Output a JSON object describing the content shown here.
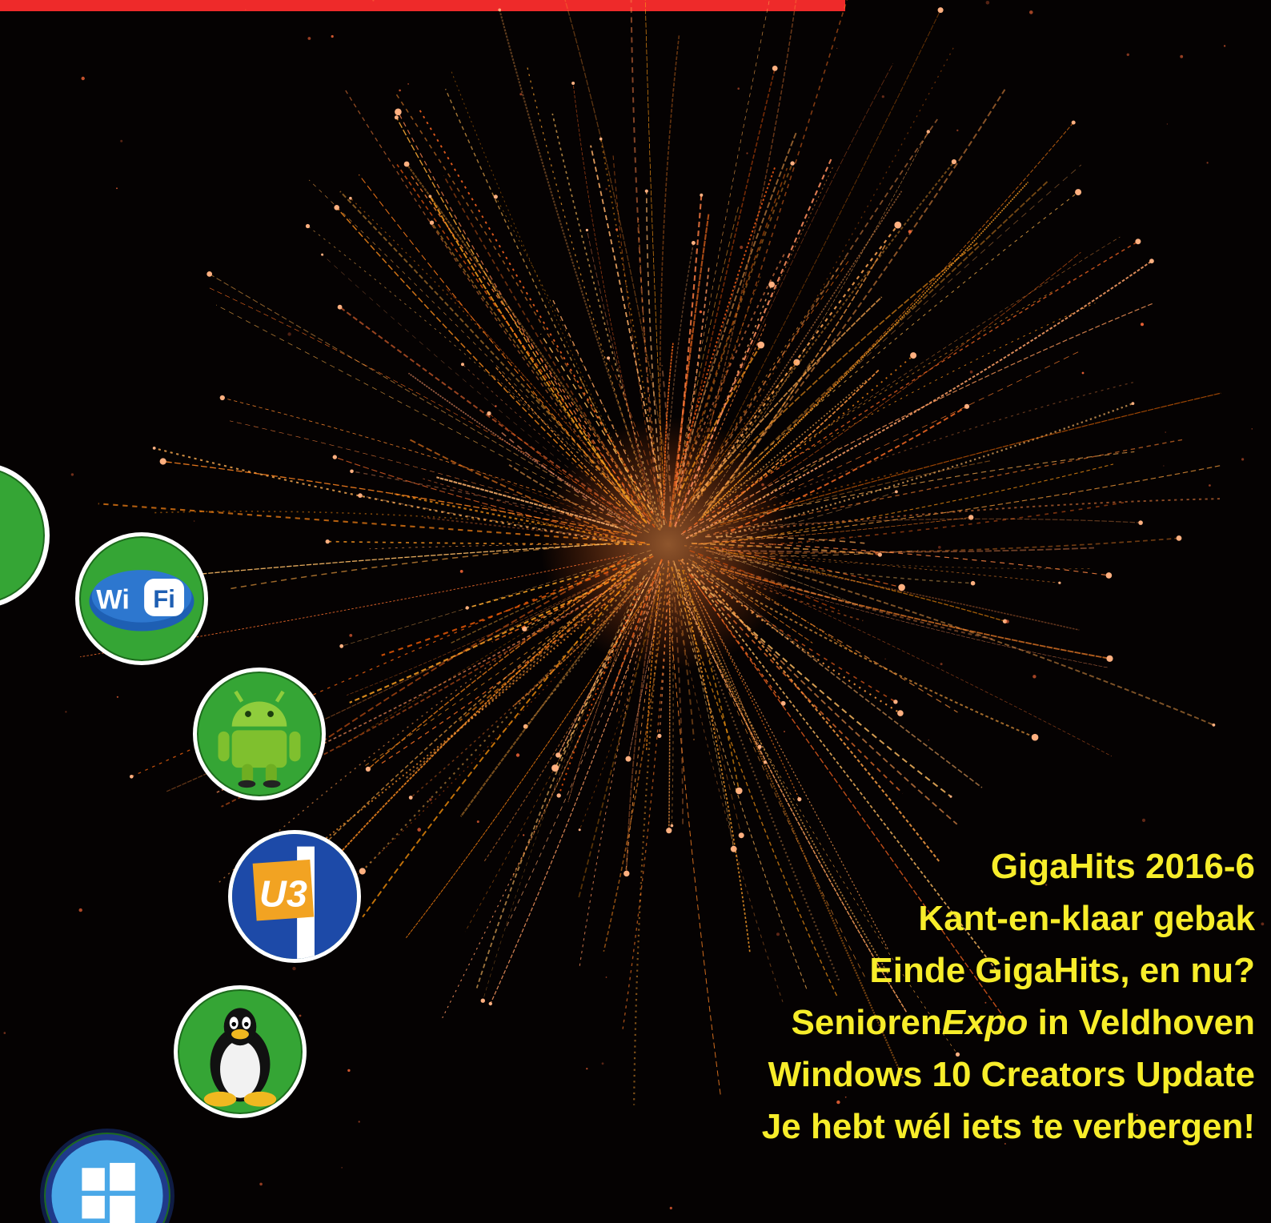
{
  "colors": {
    "background": "#050202",
    "top_bar": "#ee2a2a",
    "headline": "#f7ed2a",
    "badge_green": "#35a535",
    "spark": "#ff7a2a"
  },
  "icons": [
    "wifi-icon",
    "android-icon",
    "u3-icon",
    "linux-tux-icon",
    "windows-icon"
  ],
  "wifi_text": {
    "wi": "Wi",
    "fi": "Fi"
  },
  "u3_text": "U3",
  "headlines": [
    "GigaHits 2016-6",
    "Kant-en-klaar gebak",
    "Einde GigaHits, en nu?",
    {
      "prefix": "Senioren",
      "italic": "Expo",
      "suffix": " in Veldhoven"
    },
    "Windows 10 Creators Update",
    "Je hebt wél iets te verbergen!"
  ]
}
